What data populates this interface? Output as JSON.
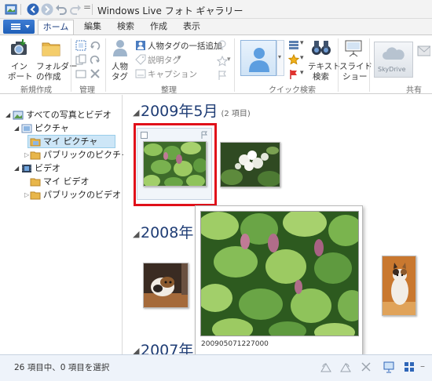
{
  "window": {
    "title": "Windows Live フォト ギャラリー"
  },
  "tabs": [
    {
      "label": "ホーム",
      "active": true
    },
    {
      "label": "編集",
      "active": false
    },
    {
      "label": "検索",
      "active": false
    },
    {
      "label": "作成",
      "active": false
    },
    {
      "label": "表示",
      "active": false
    }
  ],
  "ribbon": {
    "import_label": "インポート",
    "import_line1": "イン",
    "import_line2": "ポート",
    "folder_line1": "フォルダー",
    "folder_line2": "の作成",
    "people_line1": "人物",
    "people_line2": "タグ",
    "bulk_tag": "人物タグの一括追加",
    "desc_tag": "説明タグ",
    "caption": "キャプション",
    "text_search_line1": "テキスト",
    "text_search_line2": "検索",
    "slideshow_line1": "スライド",
    "slideshow_line2": "ショー",
    "skydrive": "SkyDrive",
    "groups": {
      "new": "新規作成",
      "manage": "管理",
      "organize": "整理",
      "quick_search": "クイック検索",
      "share": "共有"
    }
  },
  "nav": {
    "items": [
      {
        "label": "すべての写真とビデオ"
      },
      {
        "label": "ピクチャ"
      },
      {
        "label": "マイ ピクチャ"
      },
      {
        "label": "パブリックのピクチャ"
      },
      {
        "label": "ビデオ"
      },
      {
        "label": "マイ ビデオ"
      },
      {
        "label": "パブリックのビデオ"
      }
    ]
  },
  "sections": [
    {
      "heading": "2009年5月",
      "count": "(2 項目)"
    },
    {
      "heading": "2008年",
      "count": ""
    },
    {
      "heading": "2007年",
      "count": ""
    }
  ],
  "preview": {
    "caption": "200905071227000"
  },
  "status": {
    "text": "26 項目中、0 項目を選択"
  },
  "colors": {
    "accent": "#1f5fb8",
    "heading": "#1f3d75",
    "highlight": "#e0101a"
  }
}
